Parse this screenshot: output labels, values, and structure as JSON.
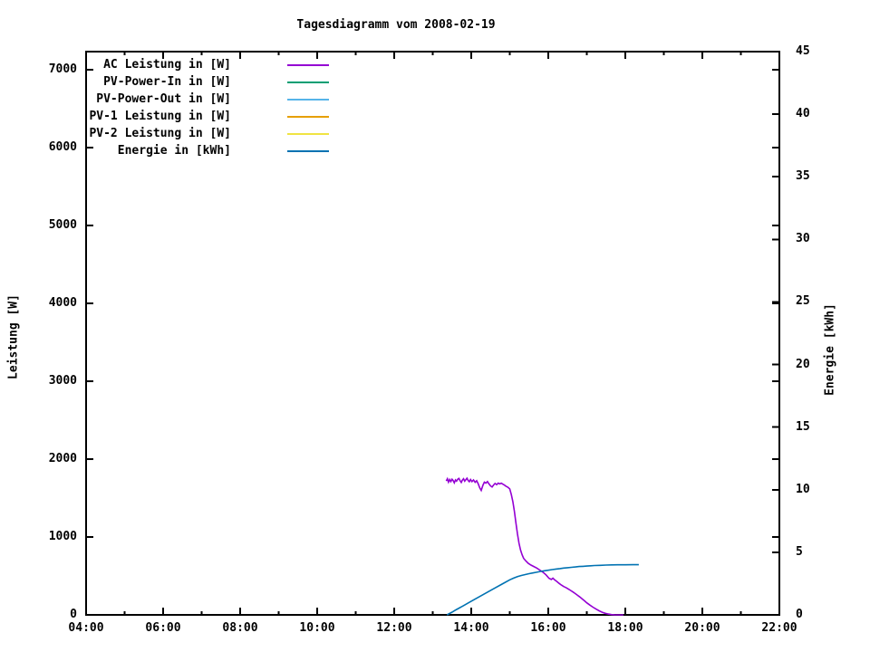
{
  "title": "Tagesdiagramm vom 2008-02-19",
  "colors": {
    "axis": "#000000",
    "background": "#ffffff"
  },
  "chart_data": {
    "type": "line",
    "title": "Tagesdiagramm vom 2008-02-19",
    "grid": "off",
    "legend_position": "top-left-inside",
    "x_axis": {
      "range_hours": [
        4,
        22
      ],
      "major": [
        {
          "t": 4,
          "label": "04:00"
        },
        {
          "t": 6,
          "label": "06:00"
        },
        {
          "t": 8,
          "label": "08:00"
        },
        {
          "t": 10,
          "label": "10:00"
        },
        {
          "t": 12,
          "label": "12:00"
        },
        {
          "t": 14,
          "label": "14:00"
        },
        {
          "t": 16,
          "label": "16:00"
        },
        {
          "t": 18,
          "label": "18:00"
        },
        {
          "t": 20,
          "label": "20:00"
        },
        {
          "t": 22,
          "label": "22:00"
        }
      ],
      "minor_hours": [
        5,
        7,
        9,
        11,
        13,
        15,
        17,
        19,
        21
      ]
    },
    "y_left": {
      "label": "Leistung [W]",
      "range": [
        0,
        7250
      ],
      "ticks": [
        {
          "v": 0,
          "label": "0"
        },
        {
          "v": 1000,
          "label": "1000"
        },
        {
          "v": 2000,
          "label": "2000"
        },
        {
          "v": 3000,
          "label": "3000"
        },
        {
          "v": 4000,
          "label": "4000"
        },
        {
          "v": 5000,
          "label": "5000"
        },
        {
          "v": 6000,
          "label": "6000"
        },
        {
          "v": 7000,
          "label": "7000"
        }
      ]
    },
    "y_right": {
      "label": "Energie [kWh]",
      "range": [
        0,
        45
      ],
      "ticks": [
        {
          "v": 0,
          "label": "0"
        },
        {
          "v": 5,
          "label": "5"
        },
        {
          "v": 10,
          "label": "10"
        },
        {
          "v": 15,
          "label": "15"
        },
        {
          "v": 20,
          "label": "20"
        },
        {
          "v": 25,
          "label": "25"
        },
        {
          "v": 30,
          "label": "30"
        },
        {
          "v": 35,
          "label": "35"
        },
        {
          "v": 40,
          "label": "40"
        },
        {
          "v": 45,
          "label": "45"
        }
      ]
    },
    "series": [
      {
        "name": "AC Leistung in [W]",
        "color": "#9400D3",
        "axis": "left",
        "points": [
          [
            13.35,
            1720
          ],
          [
            13.38,
            1748
          ],
          [
            13.41,
            1705
          ],
          [
            13.44,
            1738
          ],
          [
            13.47,
            1712
          ],
          [
            13.5,
            1742
          ],
          [
            13.53,
            1725
          ],
          [
            13.56,
            1695
          ],
          [
            13.59,
            1732
          ],
          [
            13.62,
            1718
          ],
          [
            13.65,
            1742
          ],
          [
            13.68,
            1752
          ],
          [
            13.71,
            1722
          ],
          [
            13.74,
            1700
          ],
          [
            13.77,
            1730
          ],
          [
            13.8,
            1748
          ],
          [
            13.83,
            1718
          ],
          [
            13.86,
            1736
          ],
          [
            13.89,
            1755
          ],
          [
            13.92,
            1725
          ],
          [
            13.95,
            1710
          ],
          [
            13.98,
            1738
          ],
          [
            14.02,
            1712
          ],
          [
            14.06,
            1732
          ],
          [
            14.1,
            1702
          ],
          [
            14.14,
            1722
          ],
          [
            14.18,
            1685
          ],
          [
            14.22,
            1630
          ],
          [
            14.26,
            1598
          ],
          [
            14.3,
            1662
          ],
          [
            14.34,
            1705
          ],
          [
            14.38,
            1692
          ],
          [
            14.42,
            1712
          ],
          [
            14.46,
            1682
          ],
          [
            14.5,
            1656
          ],
          [
            14.54,
            1642
          ],
          [
            14.58,
            1668
          ],
          [
            14.62,
            1688
          ],
          [
            14.66,
            1672
          ],
          [
            14.7,
            1692
          ],
          [
            14.74,
            1682
          ],
          [
            14.78,
            1692
          ],
          [
            14.82,
            1678
          ],
          [
            14.86,
            1668
          ],
          [
            14.9,
            1652
          ],
          [
            14.95,
            1640
          ],
          [
            15.0,
            1618
          ],
          [
            15.04,
            1545
          ],
          [
            15.08,
            1455
          ],
          [
            15.12,
            1330
          ],
          [
            15.16,
            1180
          ],
          [
            15.2,
            1040
          ],
          [
            15.24,
            920
          ],
          [
            15.28,
            832
          ],
          [
            15.32,
            772
          ],
          [
            15.36,
            726
          ],
          [
            15.42,
            692
          ],
          [
            15.48,
            662
          ],
          [
            15.55,
            640
          ],
          [
            15.62,
            622
          ],
          [
            15.7,
            601
          ],
          [
            15.78,
            576
          ],
          [
            15.86,
            549
          ],
          [
            15.94,
            514
          ],
          [
            16.02,
            470
          ],
          [
            16.08,
            455
          ],
          [
            16.12,
            471
          ],
          [
            16.16,
            452
          ],
          [
            16.22,
            430
          ],
          [
            16.28,
            405
          ],
          [
            16.34,
            382
          ],
          [
            16.4,
            364
          ],
          [
            16.46,
            350
          ],
          [
            16.52,
            332
          ],
          [
            16.58,
            314
          ],
          [
            16.64,
            294
          ],
          [
            16.7,
            273
          ],
          [
            16.76,
            251
          ],
          [
            16.82,
            229
          ],
          [
            16.88,
            205
          ],
          [
            16.94,
            180
          ],
          [
            17.0,
            155
          ],
          [
            17.08,
            126
          ],
          [
            17.16,
            99
          ],
          [
            17.24,
            74
          ],
          [
            17.32,
            52
          ],
          [
            17.4,
            34
          ],
          [
            17.48,
            20
          ],
          [
            17.56,
            10
          ],
          [
            17.64,
            4
          ],
          [
            17.72,
            1
          ],
          [
            17.8,
            0
          ],
          [
            17.95,
            0
          ]
        ]
      },
      {
        "name": "PV-Power-In in [W]",
        "color": "#009E73",
        "axis": "left",
        "points": []
      },
      {
        "name": "PV-Power-Out in [W]",
        "color": "#56B4E9",
        "axis": "left",
        "points": []
      },
      {
        "name": "PV-1 Leistung in [W]",
        "color": "#E69F00",
        "axis": "left",
        "points": []
      },
      {
        "name": "PV-2 Leistung in [W]",
        "color": "#F0E442",
        "axis": "left",
        "points": []
      },
      {
        "name": "Energie in [kWh]",
        "color": "#0072B2",
        "axis": "right",
        "points": [
          [
            13.37,
            0
          ],
          [
            13.5,
            0.22
          ],
          [
            13.6,
            0.4
          ],
          [
            13.8,
            0.74
          ],
          [
            14.0,
            1.09
          ],
          [
            14.2,
            1.43
          ],
          [
            14.4,
            1.78
          ],
          [
            14.6,
            2.12
          ],
          [
            14.8,
            2.46
          ],
          [
            15.0,
            2.8
          ],
          [
            15.1,
            2.94
          ],
          [
            15.2,
            3.06
          ],
          [
            15.3,
            3.15
          ],
          [
            15.4,
            3.22
          ],
          [
            15.5,
            3.29
          ],
          [
            15.6,
            3.35
          ],
          [
            15.7,
            3.41
          ],
          [
            15.8,
            3.47
          ],
          [
            15.9,
            3.52
          ],
          [
            16.0,
            3.57
          ],
          [
            16.1,
            3.62
          ],
          [
            16.2,
            3.66
          ],
          [
            16.3,
            3.7
          ],
          [
            16.4,
            3.74
          ],
          [
            16.5,
            3.77
          ],
          [
            16.6,
            3.8
          ],
          [
            16.7,
            3.83
          ],
          [
            16.8,
            3.86
          ],
          [
            16.9,
            3.88
          ],
          [
            17.0,
            3.9
          ],
          [
            17.1,
            3.92
          ],
          [
            17.2,
            3.94
          ],
          [
            17.35,
            3.96
          ],
          [
            17.5,
            3.98
          ],
          [
            17.65,
            3.99
          ],
          [
            17.8,
            4.0
          ],
          [
            18.0,
            4.0
          ],
          [
            18.2,
            4.01
          ],
          [
            18.35,
            4.01
          ]
        ]
      }
    ]
  }
}
